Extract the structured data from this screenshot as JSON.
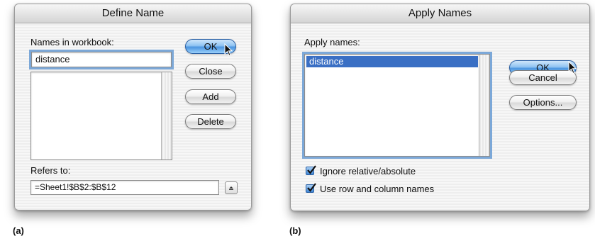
{
  "define_name": {
    "title": "Define Name",
    "names_label": "Names in workbook:",
    "names_value": "distance",
    "buttons": {
      "ok": "OK",
      "close": "Close",
      "add": "Add",
      "delete": "Delete"
    },
    "refers_label": "Refers to:",
    "refers_value": "=Sheet1!$B$2:$B$12",
    "caption": "(a)"
  },
  "apply_names": {
    "title": "Apply Names",
    "apply_label": "Apply names:",
    "list_items": [
      "distance"
    ],
    "buttons": {
      "ok": "OK",
      "cancel": "Cancel",
      "options": "Options..."
    },
    "checkboxes": [
      {
        "label": "Ignore relative/absolute",
        "checked": true
      },
      {
        "label": "Use row and column names",
        "checked": true
      }
    ],
    "caption": "(b)"
  },
  "colors": {
    "default_button": "#4b95e0",
    "selection": "#3a6fc4",
    "focus_ring": "#7ca8d8"
  }
}
